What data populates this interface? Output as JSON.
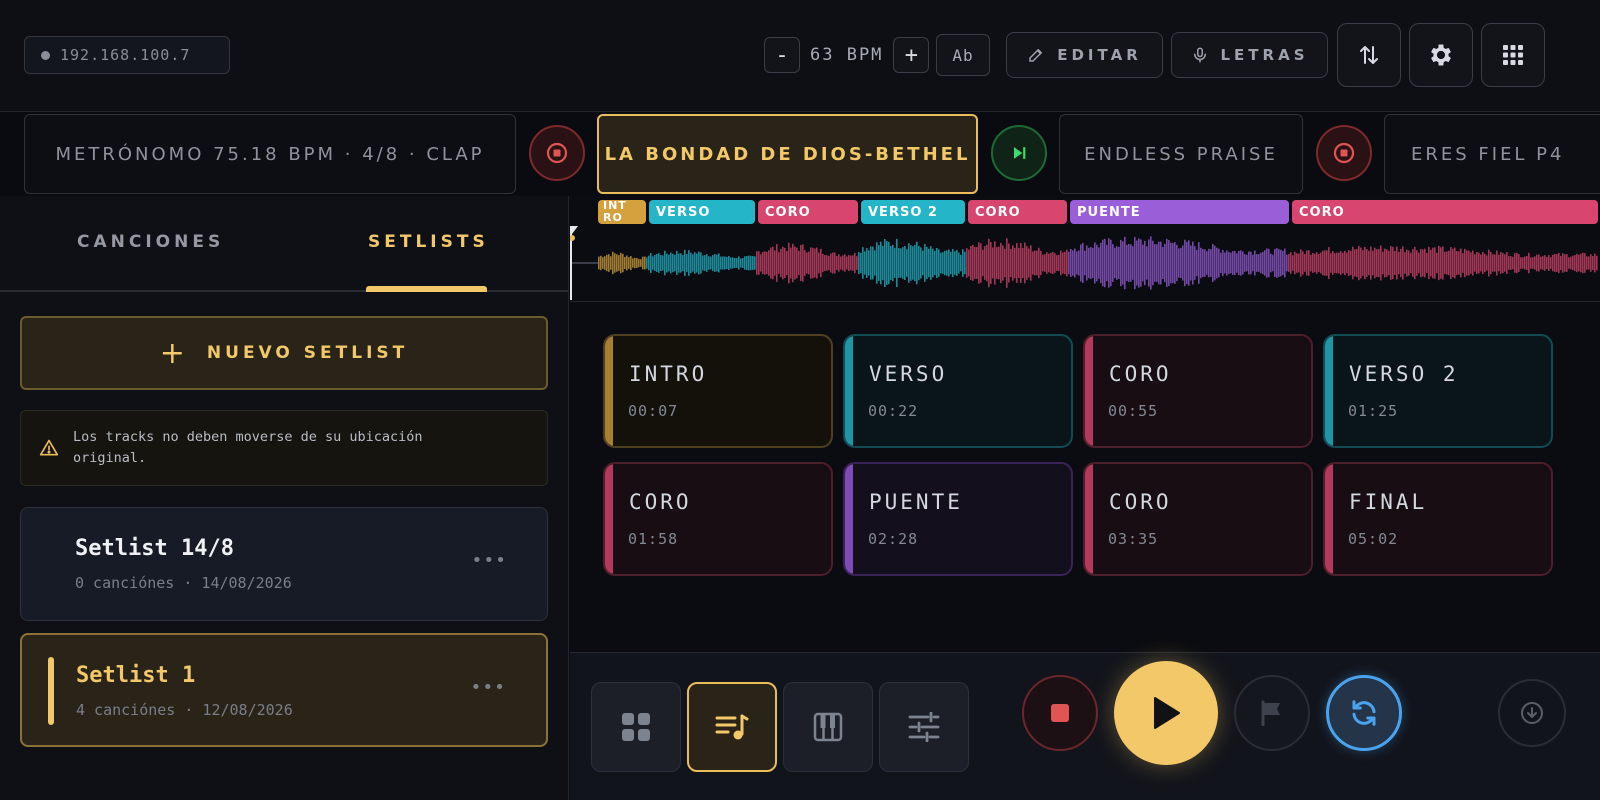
{
  "header": {
    "ip": "192.168.100.7",
    "bpm_minus": "-",
    "bpm_label": "63 BPM",
    "bpm_plus": "+",
    "key": "Ab",
    "edit_label": "EDITAR",
    "lyrics_label": "LETRAS",
    "swap_icon": "swap-vertical-icon",
    "settings_icon": "gear-icon",
    "apps_icon": "grid-icon"
  },
  "strip": {
    "metronome": "METRÓNOMO 75.18 BPM · 4/8 · CLAP",
    "current_song": "LA BONDAD DE DIOS-BETHEL",
    "next_song": "ENDLESS PRAISE",
    "later_song": "ERES FIEL P4"
  },
  "sidebar": {
    "tabs": [
      "CANCIONES",
      "SETLISTS"
    ],
    "active_tab": "SETLISTS",
    "new_setlist_label": "NUEVO SETLIST",
    "warning": "Los tracks no deben moverse de su ubicación original.",
    "setlists": [
      {
        "title": "Setlist 14/8",
        "meta": "0 canciónes · 14/08/2026",
        "active": false
      },
      {
        "title": "Setlist 1",
        "meta": "4 canciónes · 12/08/2026",
        "active": true
      }
    ]
  },
  "timeline_labels": [
    "INT RO",
    "VERSO",
    "CORO",
    "VERSO 2",
    "CORO",
    "PUENTE",
    "CORO"
  ],
  "sections": [
    {
      "name": "INTRO",
      "time": "00:07",
      "color": "#d4a13c"
    },
    {
      "name": "VERSO",
      "time": "00:22",
      "color": "#25b5c9"
    },
    {
      "name": "CORO",
      "time": "00:55",
      "color": "#d8456f"
    },
    {
      "name": "VERSO 2",
      "time": "01:25",
      "color": "#25b5c9"
    },
    {
      "name": "CORO",
      "time": "01:58",
      "color": "#d8456f"
    },
    {
      "name": "PUENTE",
      "time": "02:28",
      "color": "#9a5ed8"
    },
    {
      "name": "CORO",
      "time": "03:35",
      "color": "#d8456f"
    },
    {
      "name": "FINAL",
      "time": "05:02",
      "color": "#d8456f"
    }
  ],
  "colors": {
    "accent": "#f2c868",
    "intro": "#d4a13c",
    "verse": "#25b5c9",
    "chorus": "#d8456f",
    "bridge": "#9a5ed8",
    "stop": "#e05454",
    "play": "#f2c868",
    "loop": "#4aa3ef"
  },
  "transport_icons": [
    "grid-icon",
    "playlist-icon",
    "piano-icon",
    "sliders-icon",
    "stop-icon",
    "play-icon",
    "flag-icon",
    "loop-icon",
    "download-icon"
  ]
}
